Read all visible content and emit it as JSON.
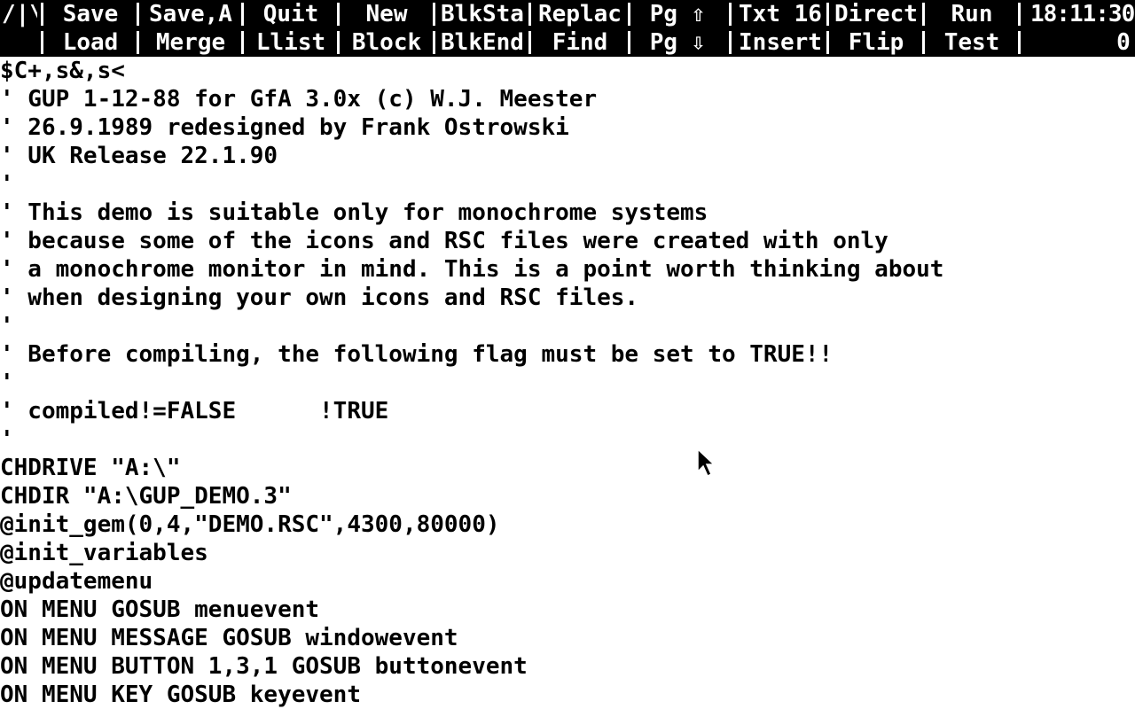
{
  "menu": {
    "logo": "/|\\|",
    "row1": [
      "Save",
      "Save,A",
      "Quit",
      "New",
      "BlkSta",
      "Replac",
      "Pg ⇧",
      "Txt 16",
      "Direct",
      "Run"
    ],
    "row2": [
      "",
      "Load",
      "Merge",
      "Llist",
      "Block",
      "BlkEnd",
      "Find",
      "Pg ⇩",
      "Insert",
      "Flip",
      "Test"
    ],
    "clock": "18:11:30",
    "indicator": "0"
  },
  "editor": {
    "lines": [
      "$C+,s&,s<",
      "' GUP 1-12-88 for GfA 3.0x (c) W.J. Meester",
      "' 26.9.1989 redesigned by Frank Ostrowski",
      "' UK Release 22.1.90",
      "'",
      "' This demo is suitable only for monochrome systems",
      "' because some of the icons and RSC files were created with only",
      "' a monochrome monitor in mind. This is a point worth thinking about",
      "' when designing your own icons and RSC files.",
      "'",
      "' Before compiling, the following flag must be set to TRUE!!",
      "'",
      "' compiled!=FALSE      !TRUE",
      "'",
      "CHDRIVE \"A:\\\"",
      "CHDIR \"A:\\GUP_DEMO.3\"",
      "@init_gem(0,4,\"DEMO.RSC\",4300,80000)",
      "@init_variables",
      "@updatemenu",
      "ON MENU GOSUB menuevent",
      "ON MENU MESSAGE GOSUB windowevent",
      "ON MENU BUTTON 1,3,1 GOSUB buttonevent",
      "ON MENU KEY GOSUB keyevent"
    ]
  }
}
